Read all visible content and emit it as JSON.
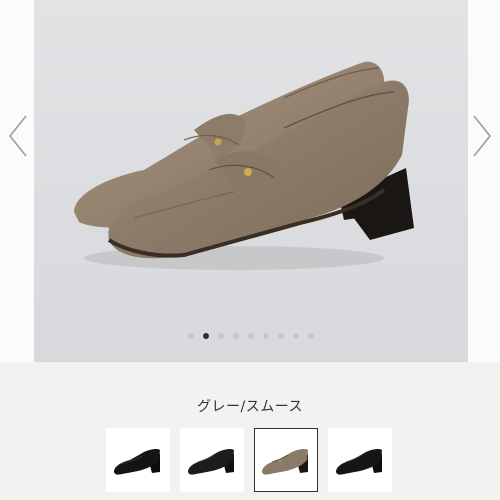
{
  "gallery": {
    "image_alt": "loafer-pumps-greige",
    "slide_count": 9,
    "active_slide": 2,
    "prev_icon": "chevron-left-icon",
    "next_icon": "chevron-right-icon"
  },
  "variant": {
    "label": "グレー/スムース"
  },
  "thumbnails": [
    {
      "color_name": "black-smooth",
      "color": "#111111",
      "selected": false
    },
    {
      "color_name": "black-smooth-2",
      "color": "#1c1c1c",
      "selected": false
    },
    {
      "color_name": "grey-smooth",
      "color": "#8c7a68",
      "selected": true
    },
    {
      "color_name": "black-variant",
      "color": "#161616",
      "selected": false
    }
  ]
}
